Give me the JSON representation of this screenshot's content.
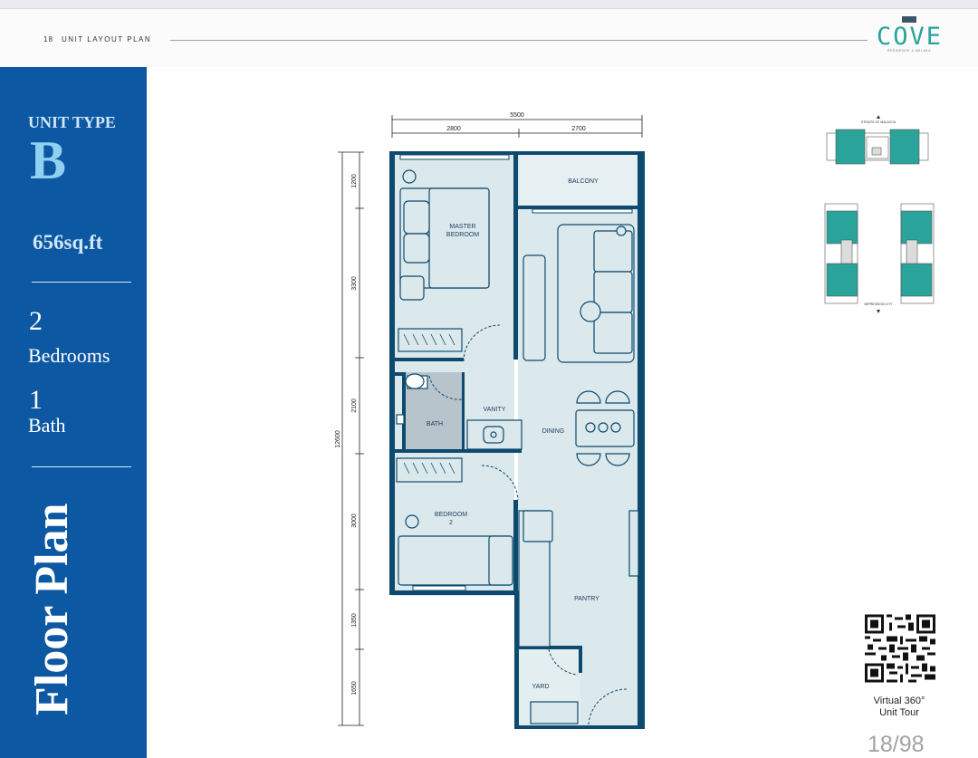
{
  "header": {
    "page_number": "18",
    "section_title": "UNIT LAYOUT PLAN",
    "logo_text": "COVE",
    "logo_subtext": "RESIDENCE & MELAKA"
  },
  "sidebar": {
    "unit_type_label": "UNIT TYPE",
    "unit_type": "B",
    "area": "656sq.ft",
    "bedrooms_count": "2",
    "bedrooms_label": "Bedrooms",
    "bath_count": "1",
    "bath_label": "Bath",
    "vertical_title": "Floor Plan"
  },
  "floorplan": {
    "rooms": {
      "master_line1": "MASTER",
      "master_line2": "BEDROOM",
      "balcony": "BALCONY",
      "vanity": "VANITY",
      "bath": "BATH",
      "dining": "DINING",
      "bedroom2_line1": "BEDROOM",
      "bedroom2_line2": "2",
      "pantry": "PANTRY",
      "yard": "YARD"
    },
    "dimensions": {
      "total_width": "5500",
      "width_left": "2800",
      "width_right": "2700",
      "total_height": "12600",
      "seg1": "1200",
      "seg2": "3300",
      "seg3": "2100",
      "seg4": "3000",
      "seg5": "1350",
      "seg6": "1650"
    }
  },
  "keyplan": {
    "top_label": "STRAITS OF MALACCA",
    "bottom_label": "IMPRESSION CITY"
  },
  "tour": {
    "line1": "Virtual 360°",
    "line2": "Unit Tour"
  },
  "pagination": "18/98",
  "colors": {
    "sidebar_blue": "#0d58a3",
    "wall": "#0d4a6e",
    "floor_fill": "#dbe9ec",
    "bath_fill": "#b8c4cb",
    "teal_accent": "#2aa39a"
  }
}
